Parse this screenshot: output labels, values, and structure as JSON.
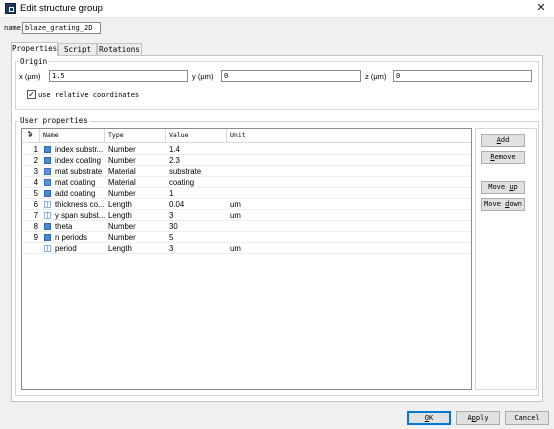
{
  "window": {
    "title": "Edit structure group",
    "close_glyph": "✕"
  },
  "name_field": {
    "label": "name",
    "value": "blaze_grating_2D"
  },
  "tabs": [
    {
      "label": "Properties"
    },
    {
      "label": "Script"
    },
    {
      "label": "Rotations"
    }
  ],
  "origin": {
    "title": "Origin",
    "x_label": "x (μm)",
    "x_value": "1.5",
    "y_label": "y (μm)",
    "y_value": "0",
    "z_label": "z (μm)",
    "z_value": "0",
    "relative_label": "use relative coordinates",
    "relative_checked": "✓"
  },
  "user_properties": {
    "title": "User properties",
    "columns": [
      "#",
      "Name",
      "Type",
      "Value",
      "Unit"
    ],
    "sort_glyph": "▲",
    "rows": [
      {
        "num": "1",
        "icon": "number-icon",
        "name": "index substr...",
        "type": "Number",
        "value": "1.4",
        "unit": ""
      },
      {
        "num": "2",
        "icon": "number-icon",
        "name": "index coating",
        "type": "Number",
        "value": "2.3",
        "unit": ""
      },
      {
        "num": "3",
        "icon": "material-icon",
        "name": "mat substrate",
        "type": "Material",
        "value": "substrate",
        "unit": ""
      },
      {
        "num": "4",
        "icon": "material-icon",
        "name": "mat coating",
        "type": "Material",
        "value": "coating",
        "unit": ""
      },
      {
        "num": "5",
        "icon": "number-icon",
        "name": "add coating",
        "type": "Number",
        "value": "1",
        "unit": ""
      },
      {
        "num": "6",
        "icon": "length-icon",
        "name": "thickness co...",
        "type": "Length",
        "value": "0.04",
        "unit": "um"
      },
      {
        "num": "7",
        "icon": "length-icon",
        "name": "y span subst...",
        "type": "Length",
        "value": "3",
        "unit": "um"
      },
      {
        "num": "8",
        "icon": "number-icon",
        "name": "theta",
        "type": "Number",
        "value": "30",
        "unit": ""
      },
      {
        "num": "9",
        "icon": "number-icon",
        "name": "n periods",
        "type": "Number",
        "value": "5",
        "unit": ""
      },
      {
        "num": "",
        "icon": "length-icon",
        "name": "period",
        "type": "Length",
        "value": "3",
        "unit": "um"
      }
    ]
  },
  "side_buttons": {
    "add": {
      "hot": "A",
      "rest": "dd"
    },
    "remove": {
      "hot": "R",
      "rest": "emove"
    },
    "move_up": {
      "pre": "Move ",
      "hot": "u",
      "rest": "p"
    },
    "move_down": {
      "pre": "Move ",
      "hot": "d",
      "rest": "own"
    }
  },
  "dialog_buttons": {
    "ok": {
      "hot": "O",
      "rest": "K"
    },
    "apply": {
      "pre": "A",
      "hot": "p",
      "rest": "ply"
    },
    "cancel": {
      "label": "Cancel"
    }
  },
  "colors": {
    "accent": "#0078d7",
    "type_icon": "#4a86d6"
  }
}
